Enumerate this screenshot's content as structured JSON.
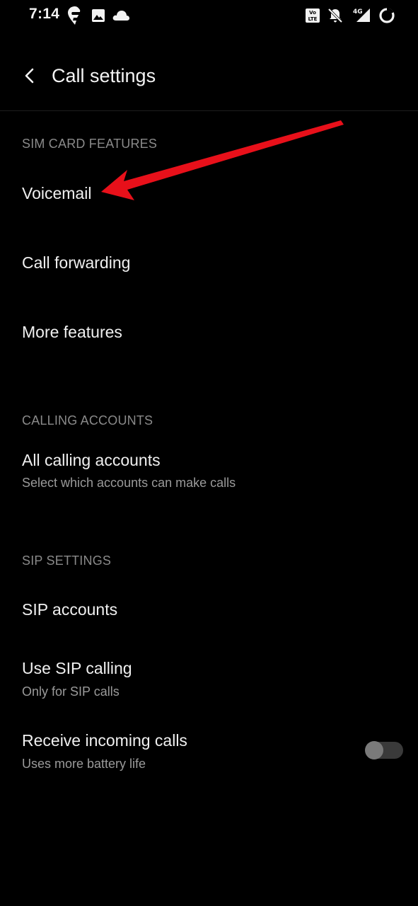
{
  "status_bar": {
    "time": "7:14",
    "icons": [
      "swiggy-icon",
      "gallery-icon",
      "cloud-icon",
      "volte-icon",
      "notifications-off-icon",
      "signal-4g-icon",
      "battery-ring-icon"
    ],
    "network_label": "4G"
  },
  "header": {
    "title": "Call settings",
    "back_icon": "chevron-left-icon"
  },
  "sections": {
    "sim_card_features": {
      "header": "SIM CARD FEATURES",
      "items": [
        {
          "title": "Voicemail"
        },
        {
          "title": "Call forwarding"
        },
        {
          "title": "More features"
        }
      ]
    },
    "calling_accounts": {
      "header": "CALLING ACCOUNTS",
      "items": [
        {
          "title": "All calling accounts",
          "subtitle": "Select which accounts can make calls"
        }
      ]
    },
    "sip_settings": {
      "header": "SIP SETTINGS",
      "items": [
        {
          "title": "SIP accounts"
        },
        {
          "title": "Use SIP calling",
          "subtitle": "Only for SIP calls"
        },
        {
          "title": "Receive incoming calls",
          "subtitle": "Uses more battery life",
          "toggle": false
        }
      ]
    }
  },
  "colors": {
    "background": "#000000",
    "annotation_arrow": "#e8101a"
  }
}
